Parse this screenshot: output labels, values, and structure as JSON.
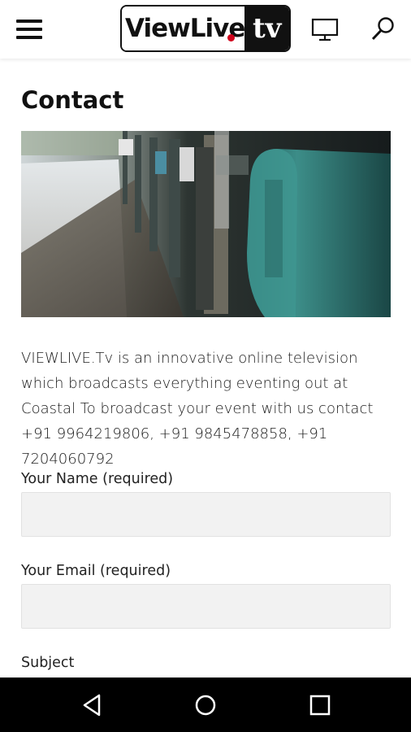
{
  "header": {
    "logo_text_main": "ViewLive",
    "logo_text_accent": "tv",
    "brand_red": "#d0021b",
    "icons": [
      "hamburger-menu-icon",
      "monitor-icon",
      "search-icon"
    ]
  },
  "page": {
    "title": "Contact",
    "hero_image": "mailboxes-photo",
    "intro": "VIEWLIVE.Tv is an innovative online television which broadcasts everything eventing out at Coastal To broadcast your event with us contact +91 9964219806, +91 9845478858, +91 7204060792"
  },
  "form": {
    "name_label": "Your Name (required)",
    "name_value": "",
    "email_label": "Your Email (required)",
    "email_value": "",
    "subject_label": "Subject"
  },
  "system_nav": {
    "icons": [
      "back-icon",
      "home-icon",
      "recents-icon"
    ]
  },
  "colors": {
    "field_background": "#f2f2f2",
    "mailbox_teal": "#2f7d7a"
  }
}
